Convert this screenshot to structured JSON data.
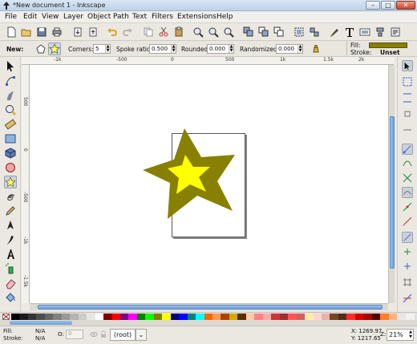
{
  "window": {
    "title": "*New document 1 - Inkscape",
    "controls": [
      "–",
      "□",
      "✕"
    ]
  },
  "menu": [
    "File",
    "Edit",
    "View",
    "Layer",
    "Object",
    "Path",
    "Text",
    "Filters",
    "Extensions",
    "Help"
  ],
  "tool_controls": {
    "new_label": "New:",
    "corners_label": "Corners:",
    "corners_value": "5",
    "spoke_label": "Spoke ratio:",
    "spoke_value": "0.500",
    "rounded_label": "Rounded:",
    "rounded_value": "0.000",
    "randomized_label": "Randomized:",
    "randomized_value": "0.000",
    "fill_label": "Fill:",
    "stroke_label": "Stroke:",
    "stroke_value": "Unset",
    "fill_color": "#878000"
  },
  "rulers": {
    "h_labels": [
      "-1k",
      "-500",
      "0",
      "500",
      "1k",
      "1.5k",
      "2k"
    ],
    "v_labels": [
      "500",
      "0",
      "-500",
      "-1k",
      "-1.5k"
    ]
  },
  "star": {
    "outer_color": "#878000",
    "inner_color": "#ffff00"
  },
  "palette": {
    "swatches": [
      "#000000",
      "#1a1a1a",
      "#333333",
      "#4d4d4d",
      "#666666",
      "#808080",
      "#999999",
      "#b3b3b3",
      "#cccccc",
      "#e6e6e6",
      "#ffffff",
      "#800000",
      "#ff0000",
      "#800080",
      "#ff00ff",
      "#008000",
      "#00ff00",
      "#808000",
      "#ffff00",
      "#000080",
      "#0000ff",
      "#008080",
      "#00ffff",
      "#ff6600",
      "#ff9955",
      "#aa4400",
      "#d4aa00",
      "#5a2d00",
      "#ffccaa",
      "#ff8080",
      "#ffaaaa",
      "#c83737",
      "#a02c2c",
      "#ff5555",
      "#d35f5f",
      "#ffeeaa",
      "#ffd5d5",
      "#e9afaf",
      "#784421",
      "#502d16",
      "#ff2a2a",
      "#d40000",
      "#aa0000",
      "#550000",
      "#ff7f2a",
      "#ffb380",
      "#e6e6e6",
      "#f2f2f2"
    ]
  },
  "status": {
    "fill_label": "Fill:",
    "fill_value": "N/A",
    "stroke_label": "Stroke:",
    "stroke_value": "N/A",
    "opacity_label": "O:",
    "opacity_value": "0",
    "layer": "(root)",
    "x_coord": "X: 1269.97",
    "y_coord": "Y: 1217.65",
    "zoom_label": "Z:",
    "zoom_value": "21%"
  }
}
